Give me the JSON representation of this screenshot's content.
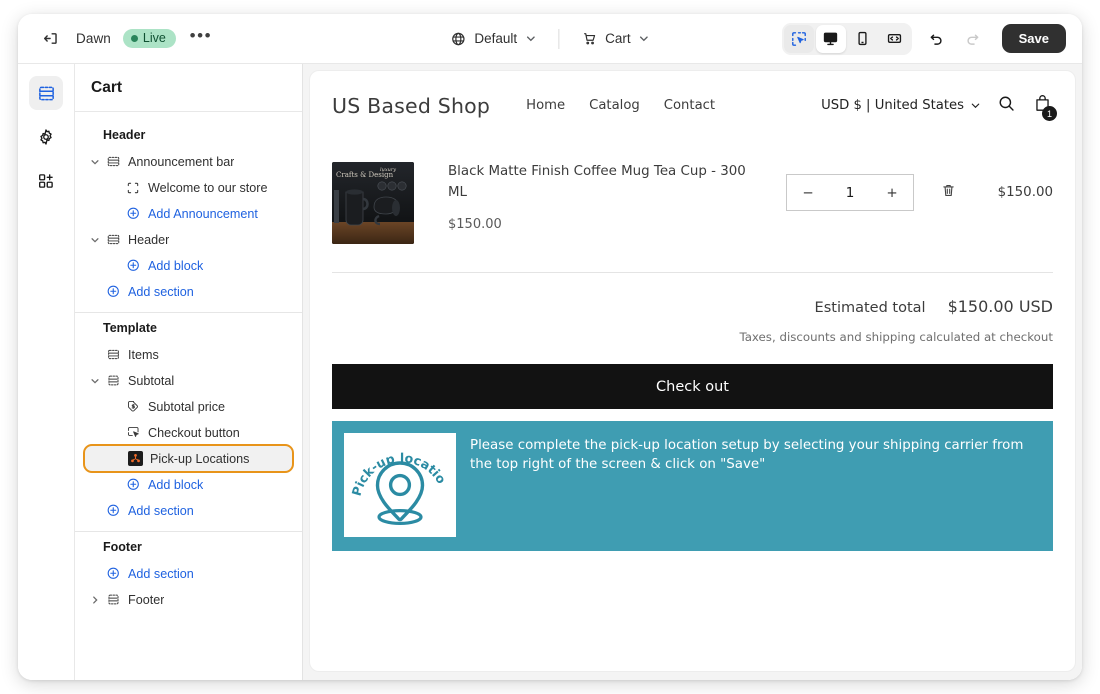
{
  "topbar": {
    "exit_icon": "exit-icon",
    "theme_name": "Dawn",
    "status_label": "Live",
    "more_label": "•••",
    "template_picker": {
      "icon": "globe-icon",
      "label": "Default",
      "chevron": "chevron-down-icon"
    },
    "page_picker": {
      "icon": "cart-icon",
      "label": "Cart",
      "chevron": "chevron-down-icon"
    },
    "view_tools": [
      {
        "name": "select-tool",
        "icon": "cursor-select-icon"
      },
      {
        "name": "desktop-view",
        "icon": "desktop-icon"
      },
      {
        "name": "mobile-view",
        "icon": "mobile-icon"
      },
      {
        "name": "fullwidth-view",
        "icon": "fullwidth-icon"
      }
    ],
    "undo_icon": "undo-icon",
    "redo_icon": "redo-icon",
    "save_label": "Save"
  },
  "rail": [
    {
      "name": "sections-icon",
      "label": "Sections",
      "active": true
    },
    {
      "name": "settings-gear-icon",
      "label": "Settings",
      "active": false
    },
    {
      "name": "apps-grid-icon",
      "label": "Apps",
      "active": false
    }
  ],
  "sidebar": {
    "title": "Cart",
    "groups": [
      {
        "title": "Header",
        "rows": [
          {
            "label": "Announcement bar",
            "icon": "section-icon",
            "caret": "expanded",
            "level": 1,
            "kind": "section"
          },
          {
            "label": "Welcome to our store",
            "icon": "block-icon",
            "caret": "none",
            "level": 2,
            "kind": "block"
          },
          {
            "label": "Add Announcement",
            "icon": "plus-circle-icon",
            "caret": "none",
            "level": 2,
            "kind": "add"
          },
          {
            "label": "Header",
            "icon": "section-icon",
            "caret": "expanded",
            "level": 1,
            "kind": "section"
          },
          {
            "label": "Add block",
            "icon": "plus-circle-icon",
            "caret": "none",
            "level": 2,
            "kind": "add"
          },
          {
            "label": "Add section",
            "icon": "plus-circle-icon",
            "caret": "none",
            "level": 1,
            "kind": "add"
          }
        ]
      },
      {
        "title": "Template",
        "rows": [
          {
            "label": "Items",
            "icon": "items-icon",
            "caret": "none",
            "level": 1,
            "kind": "section"
          },
          {
            "label": "Subtotal",
            "icon": "subtotal-icon",
            "caret": "expanded",
            "level": 1,
            "kind": "section"
          },
          {
            "label": "Subtotal price",
            "icon": "price-tag-icon",
            "caret": "none",
            "level": 2,
            "kind": "block"
          },
          {
            "label": "Checkout button",
            "icon": "button-click-icon",
            "caret": "none",
            "level": 2,
            "kind": "block"
          },
          {
            "label": "Pick-up Locations",
            "icon": "app-block-icon",
            "caret": "none",
            "level": 2,
            "kind": "app",
            "selected": true
          },
          {
            "label": "Add block",
            "icon": "plus-circle-icon",
            "caret": "none",
            "level": 2,
            "kind": "add"
          },
          {
            "label": "Add section",
            "icon": "plus-circle-icon",
            "caret": "none",
            "level": 1,
            "kind": "add"
          }
        ]
      },
      {
        "title": "Footer",
        "rows": [
          {
            "label": "Add section",
            "icon": "plus-circle-icon",
            "caret": "none",
            "level": 1,
            "kind": "add"
          },
          {
            "label": "Footer",
            "icon": "subtotal-icon",
            "caret": "collapsed",
            "level": 1,
            "kind": "section"
          }
        ]
      }
    ]
  },
  "preview": {
    "shop_name": "US Based Shop",
    "nav": [
      "Home",
      "Catalog",
      "Contact"
    ],
    "locale": "USD $ | United States",
    "locale_chevron": "chevron-down-icon",
    "search_icon": "search-icon",
    "cart_icon": "shopping-bag-icon",
    "cart_count": "1",
    "line_item": {
      "image_alt": "black-matte-mugs-photo",
      "title": "Black Matte Finish Coffee Mug Tea Cup - 300 ML",
      "unit_price": "$150.00",
      "qty_minus": "−",
      "qty_value": "1",
      "qty_plus": "+",
      "remove_icon": "trash-icon",
      "line_total": "$150.00"
    },
    "totals": {
      "estimated_label": "Estimated total",
      "estimated_value": "$150.00 USD",
      "tax_note": "Taxes, discounts and shipping calculated at checkout"
    },
    "checkout_label": "Check out",
    "pickup_banner": {
      "logo_text": "Pick-up location",
      "message": "Please complete the pick-up location setup by selecting your shipping carrier from the top right of the screen & click on \"Save\"",
      "bg_color": "#3f9db2",
      "accent_color": "#2b8ba3"
    }
  }
}
